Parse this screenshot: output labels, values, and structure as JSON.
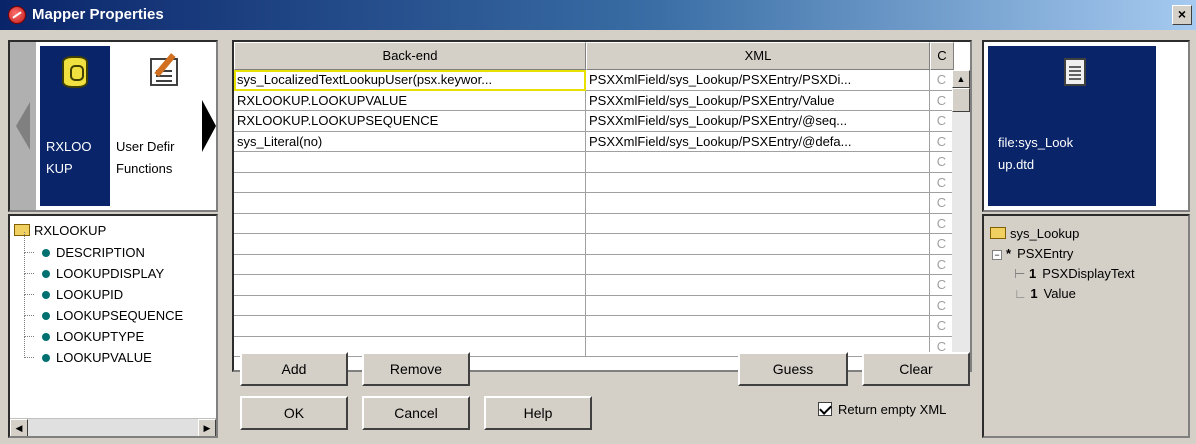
{
  "window": {
    "title": "Mapper Properties",
    "close_label": "×"
  },
  "source": {
    "cards": [
      {
        "label": "RXLOOKUP",
        "selected": true
      },
      {
        "label": "User Defined Functions",
        "selected": false
      }
    ],
    "card0_lines": [
      "RXLOO",
      "KUP"
    ],
    "card1_lines": [
      "User Defir",
      "Functions"
    ],
    "tree": {
      "root": "RXLOOKUP",
      "items": [
        "DESCRIPTION",
        "LOOKUPDISPLAY",
        "LOOKUPID",
        "LOOKUPSEQUENCE",
        "LOOKUPTYPE",
        "LOOKUPVALUE"
      ]
    }
  },
  "grid": {
    "headers": {
      "backend": "Back-end",
      "xml": "XML",
      "cond": "C"
    },
    "rows": [
      {
        "backend": "sys_LocalizedTextLookupUser(psx.keywor...",
        "xml": "PSXXmlField/sys_Lookup/PSXEntry/PSXDi...",
        "cond": "C"
      },
      {
        "backend": "RXLOOKUP.LOOKUPVALUE",
        "xml": "PSXXmlField/sys_Lookup/PSXEntry/Value",
        "cond": "C"
      },
      {
        "backend": "RXLOOKUP.LOOKUPSEQUENCE",
        "xml": "PSXXmlField/sys_Lookup/PSXEntry/@seq...",
        "cond": "C"
      },
      {
        "backend": "sys_Literal(no)",
        "xml": "PSXXmlField/sys_Lookup/PSXEntry/@defa...",
        "cond": "C"
      },
      {
        "backend": "",
        "xml": "",
        "cond": "C"
      },
      {
        "backend": "",
        "xml": "",
        "cond": "C"
      },
      {
        "backend": "",
        "xml": "",
        "cond": "C"
      },
      {
        "backend": "",
        "xml": "",
        "cond": "C"
      },
      {
        "backend": "",
        "xml": "",
        "cond": "C"
      },
      {
        "backend": "",
        "xml": "",
        "cond": "C"
      },
      {
        "backend": "",
        "xml": "",
        "cond": "C"
      },
      {
        "backend": "",
        "xml": "",
        "cond": "C"
      },
      {
        "backend": "",
        "xml": "",
        "cond": "C"
      },
      {
        "backend": "",
        "xml": "",
        "cond": "C"
      }
    ]
  },
  "buttons": {
    "add": "Add",
    "remove": "Remove",
    "guess": "Guess",
    "clear": "Clear",
    "ok": "OK",
    "cancel": "Cancel",
    "help": "Help"
  },
  "return_empty_xml": {
    "label": "Return empty XML",
    "checked": true
  },
  "target": {
    "card_lines": [
      "file:sys_Look",
      "up.dtd"
    ],
    "tree": {
      "root": "sys_Lookup",
      "entry": {
        "marker": "*",
        "label": "PSXEntry"
      },
      "children": [
        {
          "marker": "1",
          "label": "PSXDisplayText"
        },
        {
          "marker": "1",
          "label": "Value"
        }
      ]
    }
  },
  "icons": [
    "mapper-app-icon",
    "database-icon",
    "function-icon",
    "folder-icon",
    "column-dot-icon",
    "document-icon",
    "checkbox-icon"
  ]
}
